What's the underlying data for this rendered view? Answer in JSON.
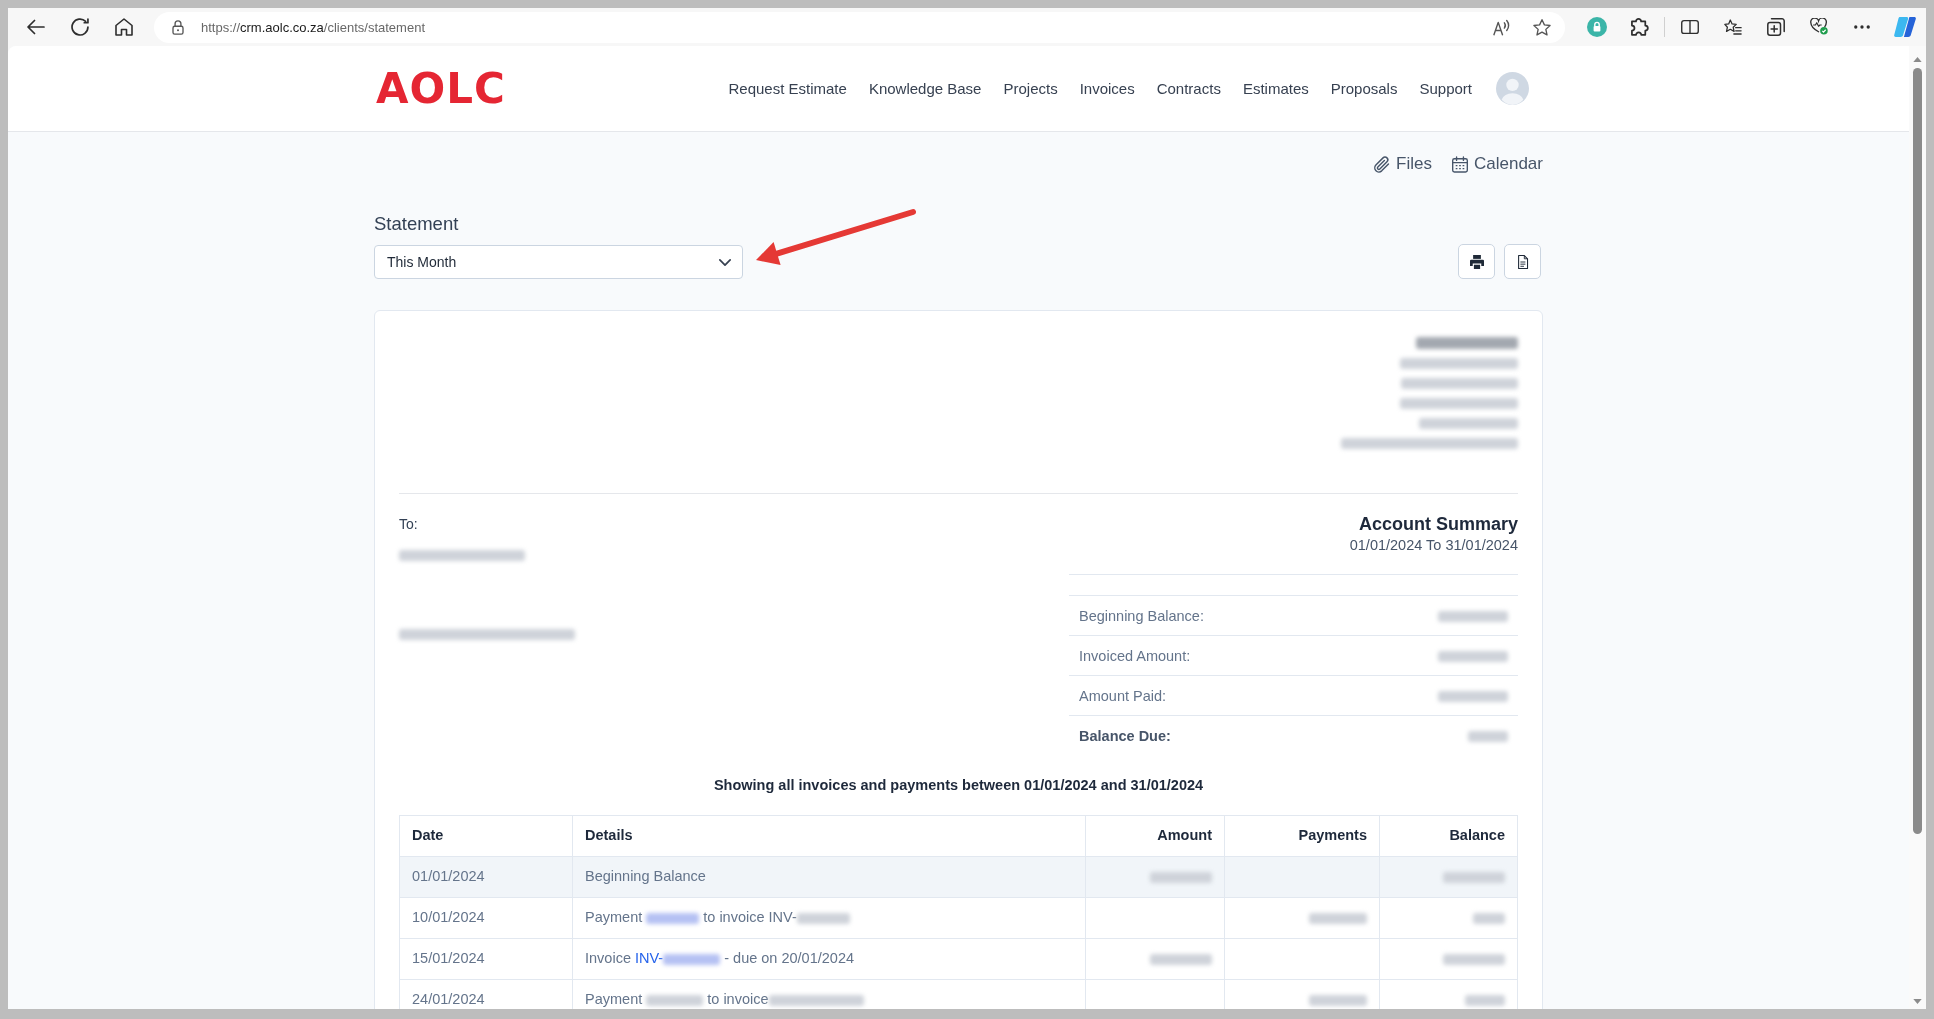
{
  "browser": {
    "url": {
      "scheme": "https://",
      "host": "crm.aolc.co.za",
      "path": "/clients/statement"
    }
  },
  "header": {
    "logo": "AOLC",
    "nav": [
      {
        "label": "Request Estimate",
        "selected": false
      },
      {
        "label": "Knowledge Base",
        "selected": false
      },
      {
        "label": "Projects",
        "selected": false
      },
      {
        "label": "Invoices",
        "selected": false
      },
      {
        "label": "Contracts",
        "selected": false
      },
      {
        "label": "Estimates",
        "selected": false
      },
      {
        "label": "Proposals",
        "selected": false
      },
      {
        "label": "Support",
        "selected": false
      }
    ]
  },
  "quick_links": [
    {
      "kind": "files",
      "label": "Files"
    },
    {
      "kind": "calendar",
      "label": "Calendar"
    }
  ],
  "statement": {
    "title": "Statement",
    "period": "This Month",
    "arrow": true,
    "actions": [
      {
        "kind": "print"
      },
      {
        "kind": "export"
      }
    ]
  },
  "company": {
    "lines": [
      {
        "redacted": true
      },
      {
        "redacted": true
      },
      {
        "redacted": true
      },
      {
        "redacted": true
      },
      {
        "redacted": true
      },
      {
        "redacted": true
      }
    ]
  },
  "recipient": {
    "label": "To:",
    "lines": [
      {
        "redacted": true
      },
      {
        "redacted": true
      }
    ]
  },
  "summary": {
    "title": "Account Summary",
    "period": "01/01/2024 To 31/01/2024",
    "rows": [
      {
        "kind": "line",
        "label": "Beginning Balance:",
        "value": {
          "redacted": true
        }
      },
      {
        "kind": "line",
        "label": "Invoiced Amount:",
        "value": {
          "redacted": true
        }
      },
      {
        "kind": "line",
        "label": "Amount Paid:",
        "value": {
          "redacted": true
        }
      },
      {
        "kind": "total",
        "label": "Balance Due:",
        "value": {
          "redacted": true
        }
      }
    ]
  },
  "transactions": {
    "caption": "Showing all invoices and payments between 01/01/2024 and 31/01/2024",
    "columns": [
      {
        "kind": "text",
        "label": "Date"
      },
      {
        "kind": "text",
        "label": "Details"
      },
      {
        "kind": "money",
        "label": "Amount"
      },
      {
        "kind": "money",
        "label": "Payments"
      },
      {
        "kind": "money",
        "label": "Balance"
      }
    ],
    "rows": [
      {
        "highlighted": true,
        "date": "01/01/2024",
        "details": [
          {
            "kind": "text",
            "text": "Beginning Balance"
          }
        ],
        "amount": {
          "redacted": true
        },
        "balance": {
          "redacted": true
        }
      },
      {
        "highlighted": false,
        "date": "10/01/2024",
        "details": [
          {
            "kind": "text",
            "text": "Payment "
          },
          {
            "kind": "redacted_link"
          },
          {
            "kind": "text",
            "text": " to invoice INV-"
          },
          {
            "kind": "redacted"
          }
        ],
        "payments": {
          "redacted": true
        },
        "balance": {
          "redacted": true
        }
      },
      {
        "highlighted": false,
        "date": "15/01/2024",
        "details": [
          {
            "kind": "text",
            "text": "Invoice "
          },
          {
            "kind": "link",
            "text": "INV-"
          },
          {
            "kind": "redacted_link"
          },
          {
            "kind": "text",
            "text": " - due on 20/01/2024"
          }
        ],
        "amount": {
          "redacted": true
        },
        "balance": {
          "redacted": true
        }
      },
      {
        "highlighted": false,
        "date": "24/01/2024",
        "details": [
          {
            "kind": "text",
            "text": "Payment "
          },
          {
            "kind": "redacted"
          },
          {
            "kind": "text",
            "text": " to invoice"
          },
          {
            "kind": "redacted"
          }
        ],
        "payments": {
          "redacted": true
        },
        "balance": {
          "redacted": true
        }
      }
    ]
  }
}
